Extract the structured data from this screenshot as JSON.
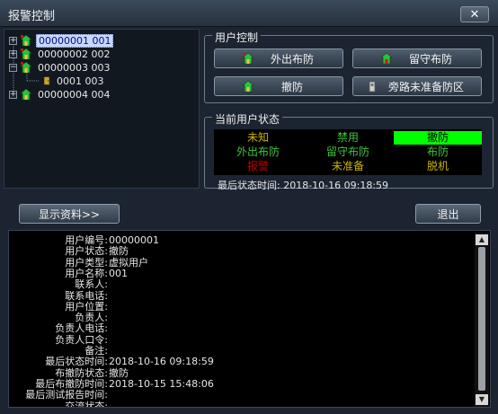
{
  "window": {
    "title": "报警控制",
    "close_label": "✕"
  },
  "tree": {
    "nodes": [
      {
        "label": "00000001 001",
        "selected": true
      },
      {
        "label": "00000002 002"
      },
      {
        "label": "00000003 003"
      },
      {
        "label": "0001 003"
      },
      {
        "label": "00000004 004"
      }
    ]
  },
  "user_control": {
    "title": "用户控制",
    "buttons": {
      "away_arm": "外出布防",
      "stay_arm": "留守布防",
      "disarm": "撤防",
      "bypass": "旁路未准备防区"
    }
  },
  "user_status": {
    "title": "当前用户状态",
    "cells": [
      {
        "label": "未知",
        "color": "#c8b400"
      },
      {
        "label": "禁用",
        "color": "#3fc23f"
      },
      {
        "label": "撤防",
        "color": "#000000",
        "bg": "#00ff00"
      },
      {
        "label": "外出布防",
        "color": "#3fc23f"
      },
      {
        "label": "留守布防",
        "color": "#3fc23f"
      },
      {
        "label": "布防",
        "color": "#3fc23f"
      },
      {
        "label": "报警",
        "color": "#c00000"
      },
      {
        "label": "未准备",
        "color": "#c8b400"
      },
      {
        "label": "脱机",
        "color": "#c8b400"
      }
    ],
    "last_time_label": "最后状态时间:",
    "last_time_value": "2018-10-16 09:18:59"
  },
  "actions": {
    "show_info": "显示资料>>",
    "exit": "退出"
  },
  "info": {
    "rows": [
      {
        "label": "用户编号:",
        "value": "00000001"
      },
      {
        "label": "用户状态:",
        "value": "撤防"
      },
      {
        "label": "用户类型:",
        "value": "虚拟用户"
      },
      {
        "label": "用户名称:",
        "value": "001"
      },
      {
        "label": "联系人:",
        "value": ""
      },
      {
        "label": "联系电话:",
        "value": ""
      },
      {
        "label": "用户位置:",
        "value": ""
      },
      {
        "label": "负责人:",
        "value": ""
      },
      {
        "label": "负责人电话:",
        "value": ""
      },
      {
        "label": "负责人口令:",
        "value": ""
      },
      {
        "label": "备注:",
        "value": ""
      },
      {
        "label": "最后状态时间:",
        "value": "2018-10-16 09:18:59"
      },
      {
        "label": "布撤防状态:",
        "value": "撤防"
      },
      {
        "label": "最后布撤防时间:",
        "value": "2018-10-15 15:48:06"
      },
      {
        "label": "最后测试报告时间:",
        "value": ""
      },
      {
        "label": "交流状态:",
        "value": ""
      }
    ]
  },
  "colors": {
    "accent": "#00ff00",
    "panel_bg": "#1b2430",
    "selection": "#c9d6ff"
  },
  "icons": {
    "user_node": "house-user-icon",
    "sub_node": "door-icon",
    "expand": "plus-icon",
    "collapse": "minus-icon"
  }
}
